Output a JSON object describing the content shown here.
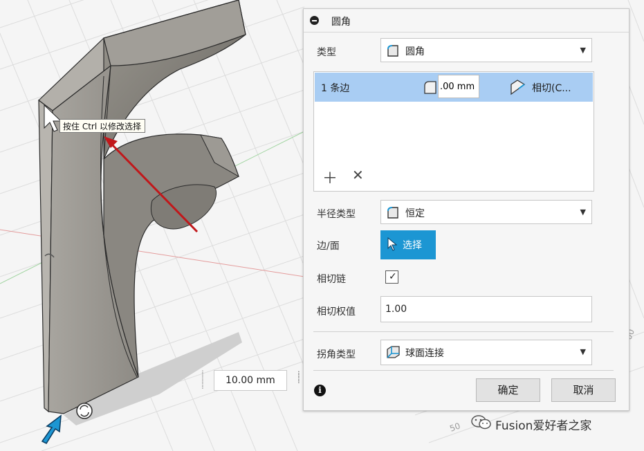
{
  "viewport": {
    "tooltip": "按住 Ctrl 以修改选择",
    "dimension_value": "10.00 mm",
    "axis_label_50": "50",
    "axis_label_00": "00"
  },
  "panel": {
    "title": "圆角",
    "type_label": "类型",
    "type_value": "圆角",
    "list": {
      "edge_count": "1 条边",
      "radius_value": ".00 mm",
      "continuity": "相切(C..."
    },
    "radius_type_label": "半径类型",
    "radius_type_value": "恒定",
    "edge_face_label": "边/面",
    "select_button": "选择",
    "tangent_chain_label": "相切链",
    "tangent_chain_checked": "✓",
    "tangent_weight_label": "相切权值",
    "tangent_weight_value": "1.00",
    "corner_type_label": "拐角类型",
    "corner_type_value": "球面连接",
    "ok_button": "确定",
    "cancel_button": "取消"
  },
  "watermark": {
    "text": "Fusion爱好者之家"
  },
  "colors": {
    "select_button": "#1c96d3",
    "list_row_highlight": "#a9cdf3",
    "arrow_red": "#c1171a",
    "model_gray": "#8d8a84"
  }
}
